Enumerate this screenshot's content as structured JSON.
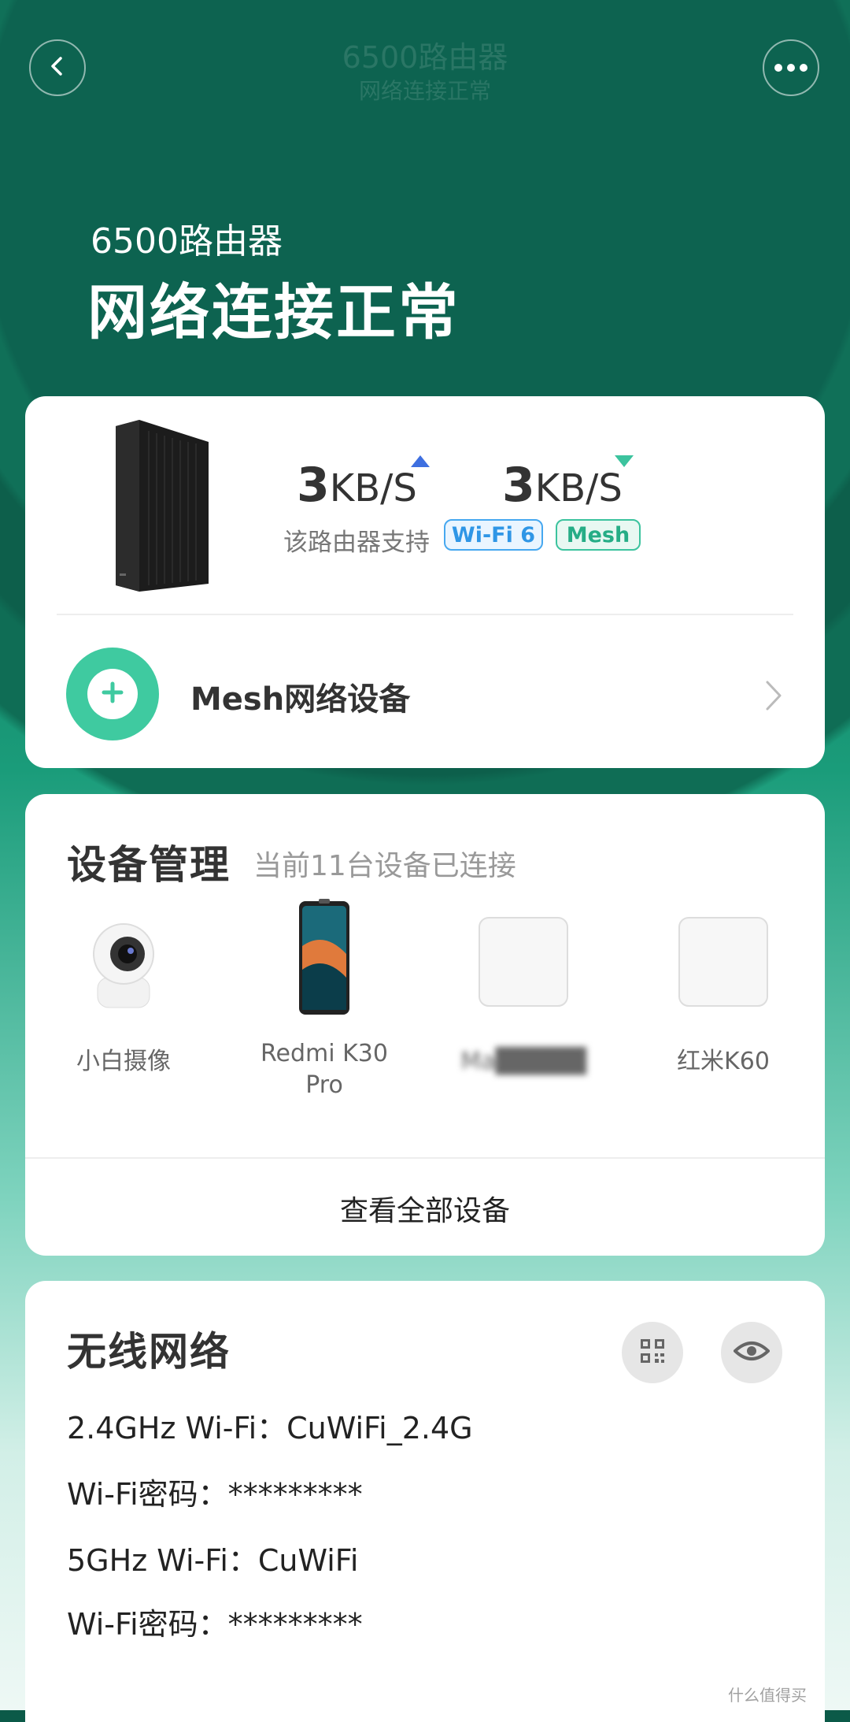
{
  "header": {
    "title": "6500路由器",
    "status": "网络连接正常"
  },
  "hero": {
    "device_name": "6500路由器",
    "status": "网络连接正常"
  },
  "router_card": {
    "upload_value": "3",
    "upload_unit": "KB/S",
    "download_value": "3",
    "download_unit": "KB/S",
    "support_label": "该路由器支持",
    "badges": [
      "Wi-Fi 6",
      "Mesh"
    ],
    "mesh_label": "Mesh网络设备"
  },
  "device_management": {
    "title": "设备管理",
    "subtitle": "当前11台设备已连接",
    "devices": [
      {
        "name": "小白摄像",
        "icon": "camera-icon"
      },
      {
        "name": "Redmi K30\nPro",
        "icon": "phone-icon"
      },
      {
        "name": "Ma█████",
        "icon": "device-box-icon"
      },
      {
        "name": "红米K60",
        "icon": "device-box-icon"
      }
    ],
    "view_all": "查看全部设备"
  },
  "wireless": {
    "title": "无线网络",
    "rows": [
      {
        "label": "2.4GHz Wi-Fi：",
        "value": "CuWiFi_2.4G"
      },
      {
        "label": "Wi-Fi密码：",
        "value": "*********"
      },
      {
        "label": "5GHz Wi-Fi：",
        "value": "CuWiFi"
      },
      {
        "label": "Wi-Fi密码：",
        "value": "*********"
      }
    ]
  },
  "watermark": "什么值得买",
  "colors": {
    "accent_green": "#3fcaa0",
    "wifi_badge": "#2f96e6",
    "up_arrow": "#3e6fe0"
  }
}
